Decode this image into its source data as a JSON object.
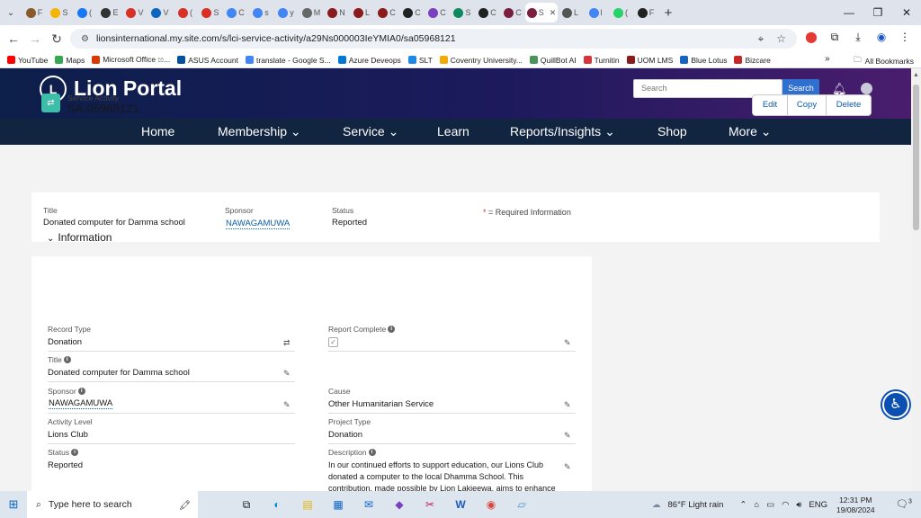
{
  "browser": {
    "tabs": [
      {
        "icon": "cookie-icon",
        "label": "F",
        "color": "#8a5a2b"
      },
      {
        "icon": "drive-icon",
        "label": "S",
        "color": "#f4b400"
      },
      {
        "icon": "facebook-icon",
        "label": "(",
        "color": "#1877f2"
      },
      {
        "icon": "bookmark-icon",
        "label": "E",
        "color": "#333333"
      },
      {
        "icon": "gmail-icon",
        "label": "V",
        "color": "#d93025"
      },
      {
        "icon": "cloud-icon",
        "label": "V",
        "color": "#0a66c2"
      },
      {
        "icon": "gmail-icon",
        "label": "(",
        "color": "#d93025"
      },
      {
        "icon": "gmail-icon",
        "label": "S",
        "color": "#d93025"
      },
      {
        "icon": "translate-icon",
        "label": "C",
        "color": "#4285f4"
      },
      {
        "icon": "google-icon",
        "label": "s",
        "color": "#4285f4"
      },
      {
        "icon": "google-icon",
        "label": "y",
        "color": "#4285f4"
      },
      {
        "icon": "university-icon",
        "label": "M",
        "color": "#666666"
      },
      {
        "icon": "lms-icon",
        "label": "N",
        "color": "#8b1a1a"
      },
      {
        "icon": "lms-icon",
        "label": "L",
        "color": "#8b1a1a"
      },
      {
        "icon": "lms-icon",
        "label": "C",
        "color": "#8b1a1a"
      },
      {
        "icon": "github-icon",
        "label": "C",
        "color": "#222222"
      },
      {
        "icon": "link-icon",
        "label": "C",
        "color": "#7b3fbf"
      },
      {
        "icon": "shield-icon",
        "label": "S",
        "color": "#0c8a5f"
      },
      {
        "icon": "github-icon",
        "label": "C",
        "color": "#222222"
      },
      {
        "icon": "lion-icon",
        "label": "C",
        "color": "#7a1f3d"
      },
      {
        "icon": "lion-icon",
        "label": "S",
        "color": "#7a1f3d"
      },
      {
        "icon": "globe-icon",
        "label": "L",
        "color": "#555555"
      },
      {
        "icon": "google-icon",
        "label": "l",
        "color": "#4285f4"
      },
      {
        "icon": "whatsapp-icon",
        "label": "(",
        "color": "#25d366"
      },
      {
        "icon": "github-icon",
        "label": "F",
        "color": "#222222"
      }
    ],
    "active_tab_index": 20,
    "active_tab_close": "✕",
    "new_tab": "+",
    "url": "lionsinternational.my.site.com/s/lci-service-activity/a29Ns000003IeYMIA0/sa05968121",
    "bookmarks": [
      {
        "label": "YouTube",
        "color": "#ff0000"
      },
      {
        "label": "Maps",
        "color": "#34a853"
      },
      {
        "label": "Microsoft Office හ...",
        "color": "#d83b01"
      },
      {
        "label": "ASUS Account",
        "color": "#00539b"
      },
      {
        "label": "translate - Google S...",
        "color": "#4285f4"
      },
      {
        "label": "Azure Deveops",
        "color": "#0078d4"
      },
      {
        "label": "SLT",
        "color": "#1e88e5"
      },
      {
        "label": "Coventry University...",
        "color": "#f2a900"
      },
      {
        "label": "QuillBot AI",
        "color": "#499557"
      },
      {
        "label": "Turnitin",
        "color": "#d4363c"
      },
      {
        "label": "UOM LMS",
        "color": "#8b1a1a"
      },
      {
        "label": "Blue Lotus",
        "color": "#1565c0"
      },
      {
        "label": "Bizcare",
        "color": "#c62828"
      }
    ],
    "all_bookmarks": "All Bookmarks"
  },
  "portal": {
    "logo_text": "L",
    "brand": "Lion Portal",
    "search_placeholder": "Search",
    "search_button": "Search",
    "menu": [
      "Home",
      "Membership",
      "Service",
      "Learn",
      "Reports/Insights",
      "Shop",
      "More"
    ],
    "menu_dropdown_marker": "⌄"
  },
  "record": {
    "object_type": "Service Activity",
    "name": "SA-05968121",
    "actions": [
      "Edit",
      "Copy",
      "Delete"
    ],
    "highlights": {
      "title_label": "Title",
      "title_value": "Donated computer for Damma school",
      "sponsor_label": "Sponsor",
      "sponsor_value": "NAWAGAMUWA",
      "status_label": "Status",
      "status_value": "Reported"
    }
  },
  "detail": {
    "required_star": "*",
    "required_text": " = Required Information",
    "section_title": "Information",
    "record_type_label": "Record Type",
    "record_type_value": "Donation",
    "report_complete_label": "Report Complete",
    "report_complete_checked": true,
    "title_label": "Title",
    "title_value": "Donated computer for Damma school",
    "sponsor_label": "Sponsor",
    "sponsor_value": "NAWAGAMUWA",
    "cause_label": "Cause",
    "cause_value": "Other Humanitarian Service",
    "activity_level_label": "Activity Level",
    "activity_level_value": "Lions Club",
    "project_type_label": "Project Type",
    "project_type_value": "Donation",
    "status_label": "Status",
    "status_value": "Reported",
    "description_label": "Description",
    "description_value": "In our continued efforts to support education, our Lions Club donated a computer to the local Dhamma School. This contribution, made possible by Lion Lakjeewa, aims to enhance"
  },
  "taskbar": {
    "search_placeholder": "Type here to search",
    "weather": "86°F  Light rain",
    "language": "ENG",
    "time": "12:31 PM",
    "date": "19/08/2024",
    "notification_count": "3"
  }
}
